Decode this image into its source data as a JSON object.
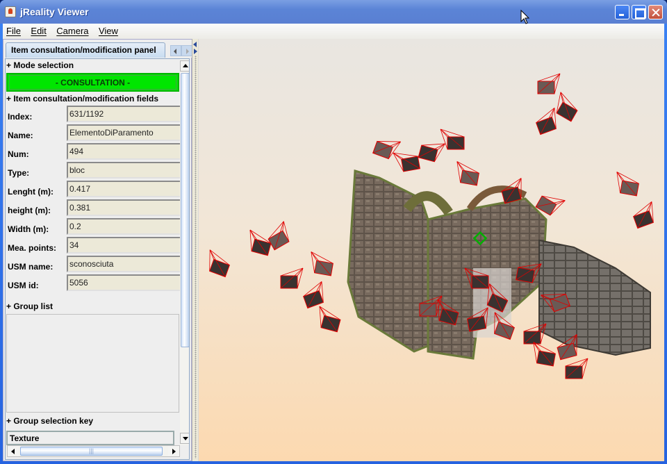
{
  "window": {
    "title": "jReality Viewer"
  },
  "menu": [
    "File",
    "Edit",
    "Camera",
    "View"
  ],
  "tab": {
    "label": "Item consultation/modification panel"
  },
  "sections": {
    "mode_selection": "+ Mode selection",
    "fields": "+ Item consultation/modification fields",
    "group_list": "+ Group list",
    "group_selection_key": "+ Group selection key"
  },
  "mode_button": {
    "label": "- CONSULTATION -",
    "color": "#00e600"
  },
  "fields": [
    {
      "label": "Index:",
      "value": "631/1192"
    },
    {
      "label": "Name:",
      "value": "ElementoDiParamento"
    },
    {
      "label": "Num:",
      "value": "494"
    },
    {
      "label": "Type:",
      "value": "bloc"
    },
    {
      "label": "Lenght (m):",
      "value": "0.417"
    },
    {
      "label": "height (m):",
      "value": "0.381"
    },
    {
      "label": "Width (m):",
      "value": "0.2"
    },
    {
      "label": "Mea. points:",
      "value": "34"
    },
    {
      "label": "USM name:",
      "value": "sconosciuta"
    },
    {
      "label": "USM id:",
      "value": "5056"
    }
  ],
  "group_list": [],
  "group_selection_key": {
    "selected": "Texture"
  },
  "scrollbar_grip": "|||",
  "viewport": {
    "description": "3D point-cloud reconstruction of ruined stone wall with camera frustums",
    "camera_color": "#e00000",
    "selection_color": "#00b000"
  }
}
